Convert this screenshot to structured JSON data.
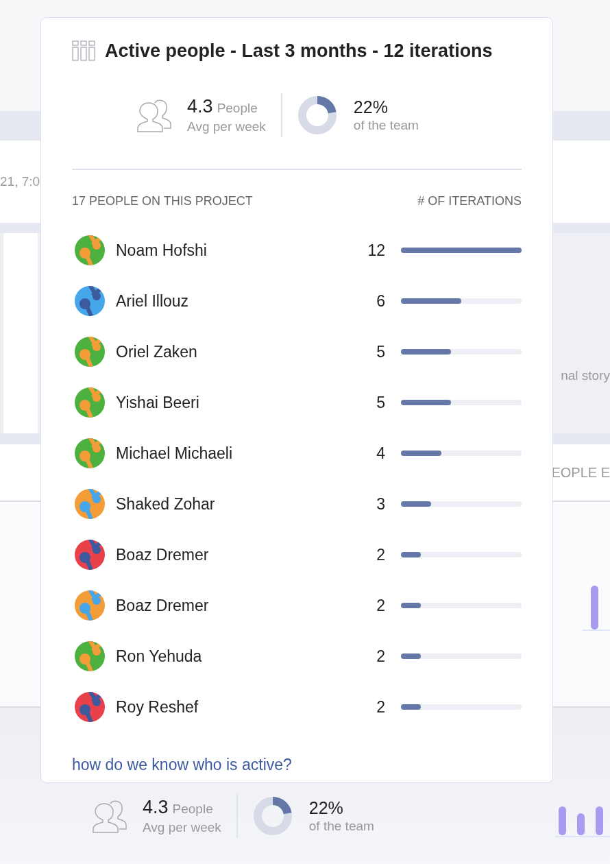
{
  "background": {
    "timestamp_fragment": "21, 7:0",
    "legend_fragment": "nal story",
    "section_fragment": "EOPLE E",
    "stats": {
      "value": "4.3",
      "unit": "People",
      "caption": "Avg per week",
      "percent": "22%",
      "percent_caption": "of the team"
    }
  },
  "popup": {
    "title": "Active people - Last 3 months - 12 iterations",
    "stats": {
      "value": "4.3",
      "unit": "People",
      "caption": "Avg per week",
      "percent": "22%",
      "percent_caption": "of the team"
    },
    "list_heading": "17 PEOPLE ON THIS PROJECT",
    "count_heading": "# OF ITERATIONS",
    "people": [
      {
        "name": "Noam Hofshi",
        "count": "12",
        "level": 1,
        "color": "#4db13f"
      },
      {
        "name": "Ariel Illouz",
        "count": "6",
        "level": 0.5,
        "color": "#46a6ea"
      },
      {
        "name": "Oriel Zaken",
        "count": "5",
        "level": 0.417,
        "color": "#4db13f"
      },
      {
        "name": "Yishai Beeri",
        "count": "5",
        "level": 0.417,
        "color": "#4db13f"
      },
      {
        "name": "Michael Michaeli",
        "count": "4",
        "level": 0.333,
        "color": "#4db13f"
      },
      {
        "name": "Shaked Zohar",
        "count": "3",
        "level": 0.25,
        "color": "#f39c38"
      },
      {
        "name": "Boaz Dremer",
        "count": "2",
        "level": 0.167,
        "color": "#e8414a"
      },
      {
        "name": "Boaz Dremer",
        "count": "2",
        "level": 0.167,
        "color": "#f39c38"
      },
      {
        "name": "Ron Yehuda",
        "count": "2",
        "level": 0.167,
        "color": "#4db13f"
      },
      {
        "name": "Roy Reshef",
        "count": "2",
        "level": 0.167,
        "color": "#e8414a"
      }
    ],
    "help_link": "how do we know who is active?"
  }
}
